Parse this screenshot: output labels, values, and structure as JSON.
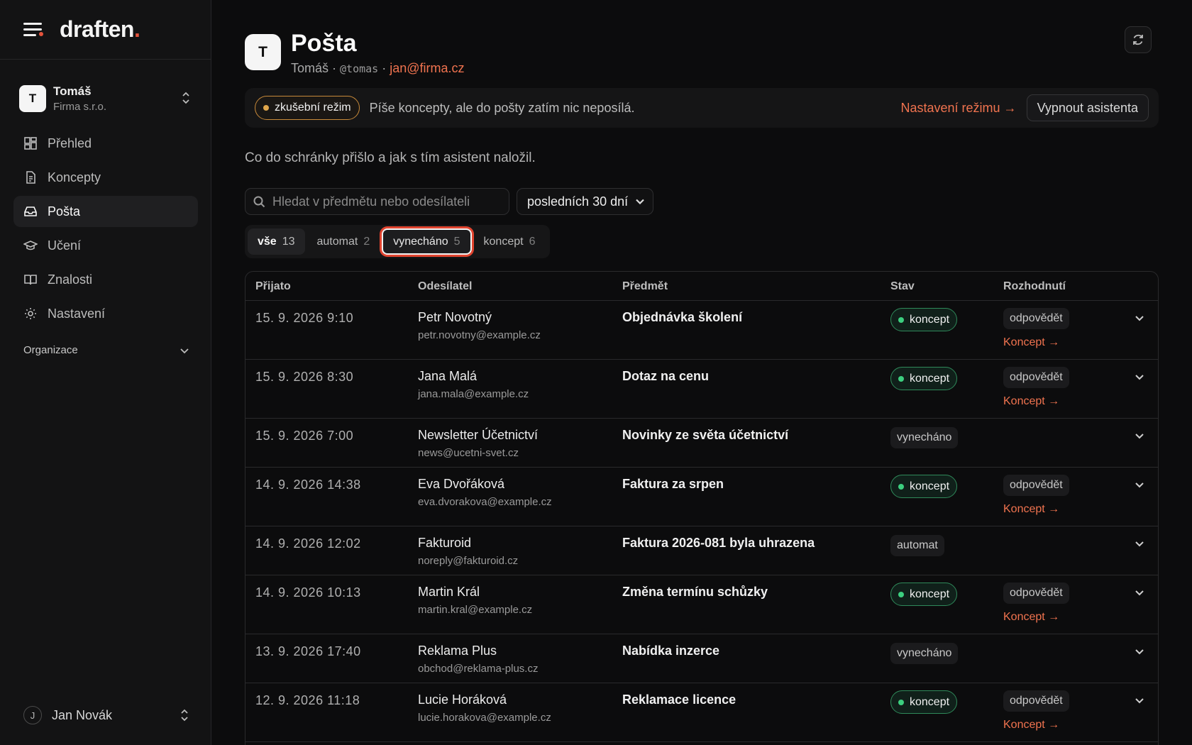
{
  "brand": {
    "name": "draften",
    "dot": "."
  },
  "org": {
    "avatar": "T",
    "name": "Tomáš",
    "company": "Firma s.r.o."
  },
  "nav": [
    {
      "label": "Přehled",
      "icon": "dashboard-icon"
    },
    {
      "label": "Koncepty",
      "icon": "document-icon"
    },
    {
      "label": "Pošta",
      "icon": "inbox-icon",
      "active": true
    },
    {
      "label": "Učení",
      "icon": "graduation-cap-icon"
    },
    {
      "label": "Znalosti",
      "icon": "book-icon"
    },
    {
      "label": "Nastavení",
      "icon": "gear-icon"
    }
  ],
  "org_section": {
    "label": "Organizace"
  },
  "user": {
    "avatar": "J",
    "name": "Jan Novák"
  },
  "page": {
    "avatar": "T",
    "title": "Pošta",
    "sub_name": "Tomáš",
    "sub_sep": " · ",
    "sub_handle": "@tomas",
    "sub_sep2": " · ",
    "sub_email": "jan@firma.cz"
  },
  "banner": {
    "mode_label": "zkušební režim",
    "text": "Píše koncepty, ale do pošty zatím nic neposílá.",
    "link": "Nastavení režimu →",
    "button": "Vypnout asistenta"
  },
  "description": "Co do schránky přišlo a jak s tím asistent naložil.",
  "search": {
    "placeholder": "Hledat v předmětu nebo odesílateli"
  },
  "filter": {
    "selected": "posledních 30 dní"
  },
  "tabs": [
    {
      "label": "vše",
      "count": "13"
    },
    {
      "label": "automat",
      "count": "2"
    },
    {
      "label": "vynecháno",
      "count": "5"
    },
    {
      "label": "koncept",
      "count": "6"
    }
  ],
  "table": {
    "columns": [
      "Přijato",
      "Odesílatel",
      "Předmět",
      "Stav",
      "Rozhodnutí"
    ],
    "rows": [
      {
        "date": "15. 9. 2026 9:10",
        "name": "Petr Novotný",
        "email": "petr.novotny@example.cz",
        "subject": "Objednávka školení",
        "state": "koncept",
        "decision": "odpovědět",
        "link": "Koncept →"
      },
      {
        "date": "15. 9. 2026 8:30",
        "name": "Jana Malá",
        "email": "jana.mala@example.cz",
        "subject": "Dotaz na cenu",
        "state": "koncept",
        "decision": "odpovědět",
        "link": "Koncept →"
      },
      {
        "date": "15. 9. 2026 7:00",
        "name": "Newsletter Účetnictví",
        "email": "news@ucetni-svet.cz",
        "subject": "Novinky ze světa účetnictví",
        "state": "vynecháno",
        "decision": "",
        "link": ""
      },
      {
        "date": "14. 9. 2026 14:38",
        "name": "Eva Dvořáková",
        "email": "eva.dvorakova@example.cz",
        "subject": "Faktura za srpen",
        "state": "koncept",
        "decision": "odpovědět",
        "link": "Koncept →"
      },
      {
        "date": "14. 9. 2026 12:02",
        "name": "Fakturoid",
        "email": "noreply@fakturoid.cz",
        "subject": "Faktura 2026-081 byla uhrazena",
        "state": "automat",
        "decision": "",
        "link": ""
      },
      {
        "date": "14. 9. 2026 10:13",
        "name": "Martin Král",
        "email": "martin.kral@example.cz",
        "subject": "Změna termínu schůzky",
        "state": "koncept",
        "decision": "odpovědět",
        "link": "Koncept →"
      },
      {
        "date": "13. 9. 2026 17:40",
        "name": "Reklama Plus",
        "email": "obchod@reklama-plus.cz",
        "subject": "Nabídka inzerce",
        "state": "vynecháno",
        "decision": "",
        "link": ""
      },
      {
        "date": "12. 9. 2026 11:18",
        "name": "Lucie Horáková",
        "email": "lucie.horakova@example.cz",
        "subject": "Reklamace licence",
        "state": "koncept",
        "decision": "odpovědět",
        "link": "Koncept →"
      }
    ]
  },
  "colors": {
    "accent": "#f0734f",
    "brand_dot": "#e5533c",
    "koncept_green": "#3ccf7f",
    "trial_amber": "#e0a64b"
  }
}
